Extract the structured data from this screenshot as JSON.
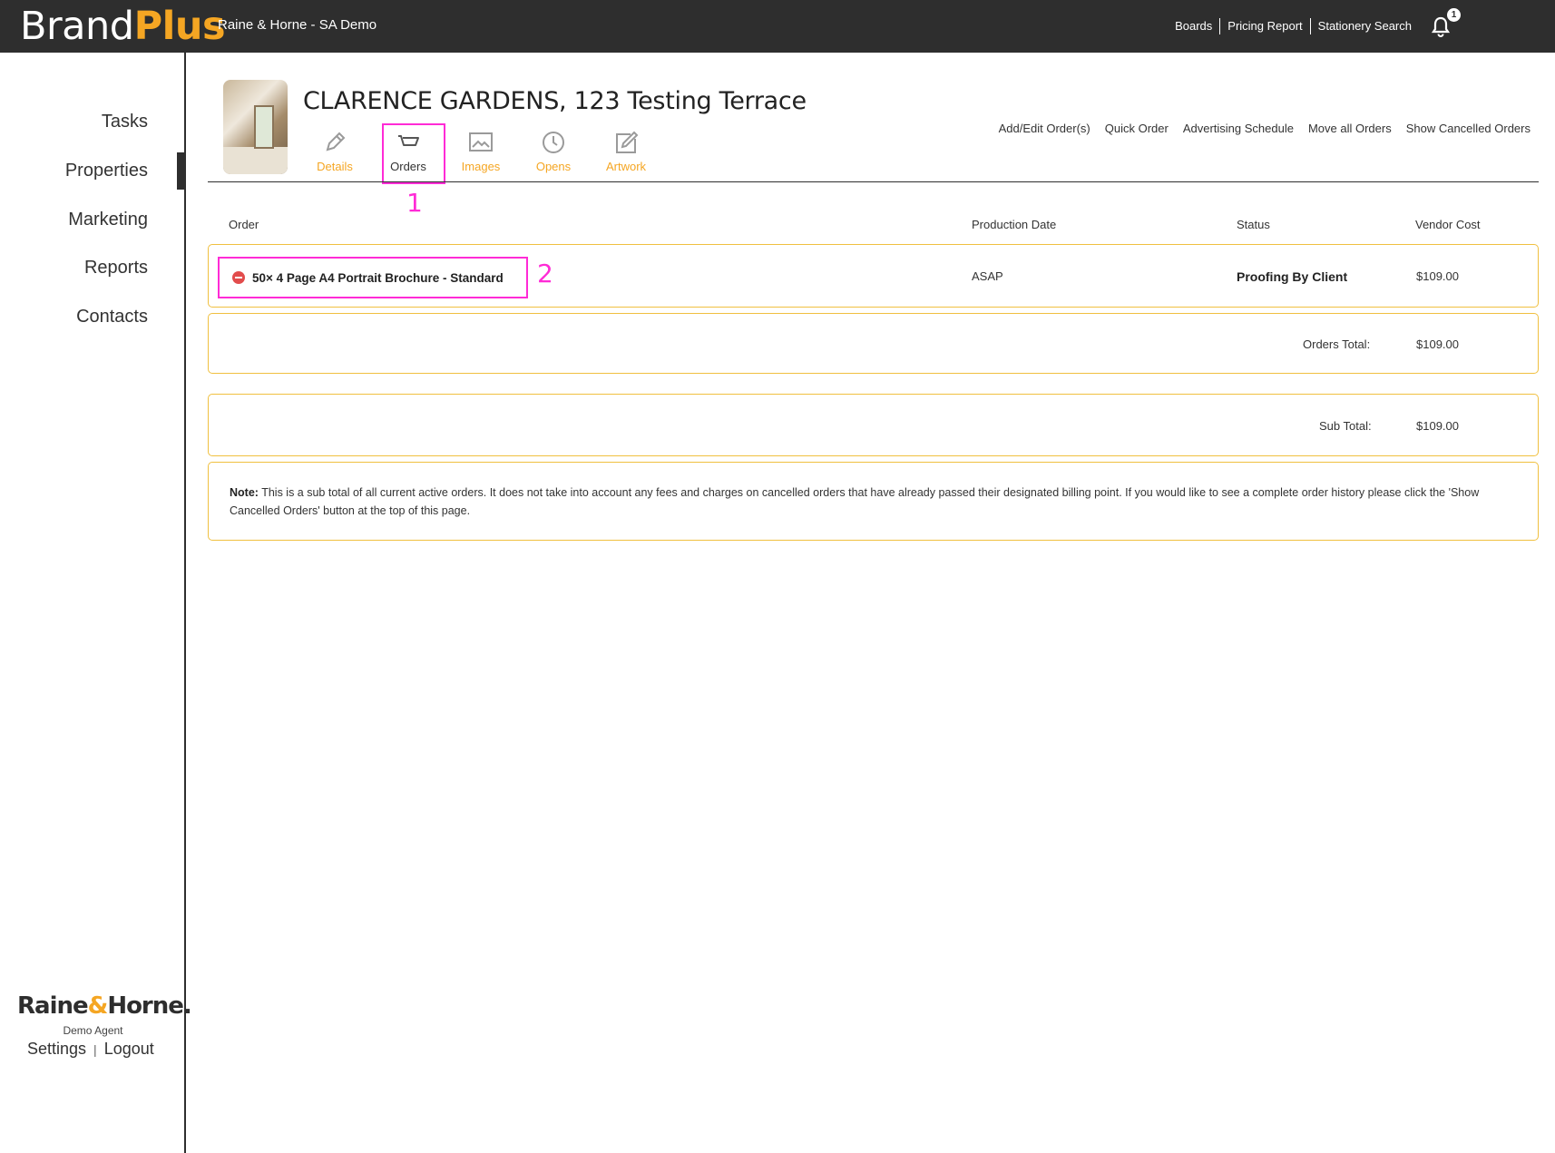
{
  "app": {
    "logo_brand": "Brand",
    "logo_plus": "Plus",
    "office": "Raine & Horne - SA Demo"
  },
  "topnav": {
    "items": [
      "Boards",
      "Pricing Report",
      "Stationery Search"
    ],
    "notification_count": "1"
  },
  "sidebar": {
    "items": [
      "Tasks",
      "Properties",
      "Marketing",
      "Reports",
      "Contacts"
    ],
    "active": "Properties",
    "company_logo_1": "Raine",
    "company_logo_amp": "&",
    "company_logo_2": "Horne.",
    "agent": "Demo Agent",
    "settings": "Settings",
    "separator": "|",
    "logout": "Logout"
  },
  "property": {
    "title": "CLARENCE GARDENS, 123 Testing Terrace",
    "tabs": [
      {
        "label": "Details",
        "icon": "pencil-icon"
      },
      {
        "label": "Orders",
        "icon": "cart-icon"
      },
      {
        "label": "Images",
        "icon": "image-icon"
      },
      {
        "label": "Opens",
        "icon": "clock-icon"
      },
      {
        "label": "Artwork",
        "icon": "edit-square-icon"
      }
    ],
    "active_tab": "Orders",
    "actions": [
      "Add/Edit Order(s)",
      "Quick Order",
      "Advertising Schedule",
      "Move all Orders",
      "Show Cancelled Orders"
    ]
  },
  "annotations": {
    "one": "1",
    "two": "2"
  },
  "orders": {
    "columns": [
      "Order",
      "Production Date",
      "Status",
      "Vendor Cost"
    ],
    "rows": [
      {
        "name": "50× 4 Page A4 Portrait Brochure - Standard",
        "production_date": "ASAP",
        "status": "Proofing By Client",
        "vendor_cost": "$109.00"
      }
    ],
    "orders_total_label": "Orders Total:",
    "orders_total": "$109.00",
    "sub_total_label": "Sub Total:",
    "sub_total": "$109.00",
    "note_label": "Note:",
    "note_text": "This is a sub total of all current active orders. It does not take into account any fees and charges on cancelled orders that have already passed their designated billing point. If you would like to see a complete order history please click the 'Show Cancelled Orders' button at the top of this page."
  },
  "colors": {
    "topbar": "#2e2e2e",
    "accent": "#f5a623",
    "highlight": "#ff2bd6",
    "box_border": "#f0c040"
  }
}
